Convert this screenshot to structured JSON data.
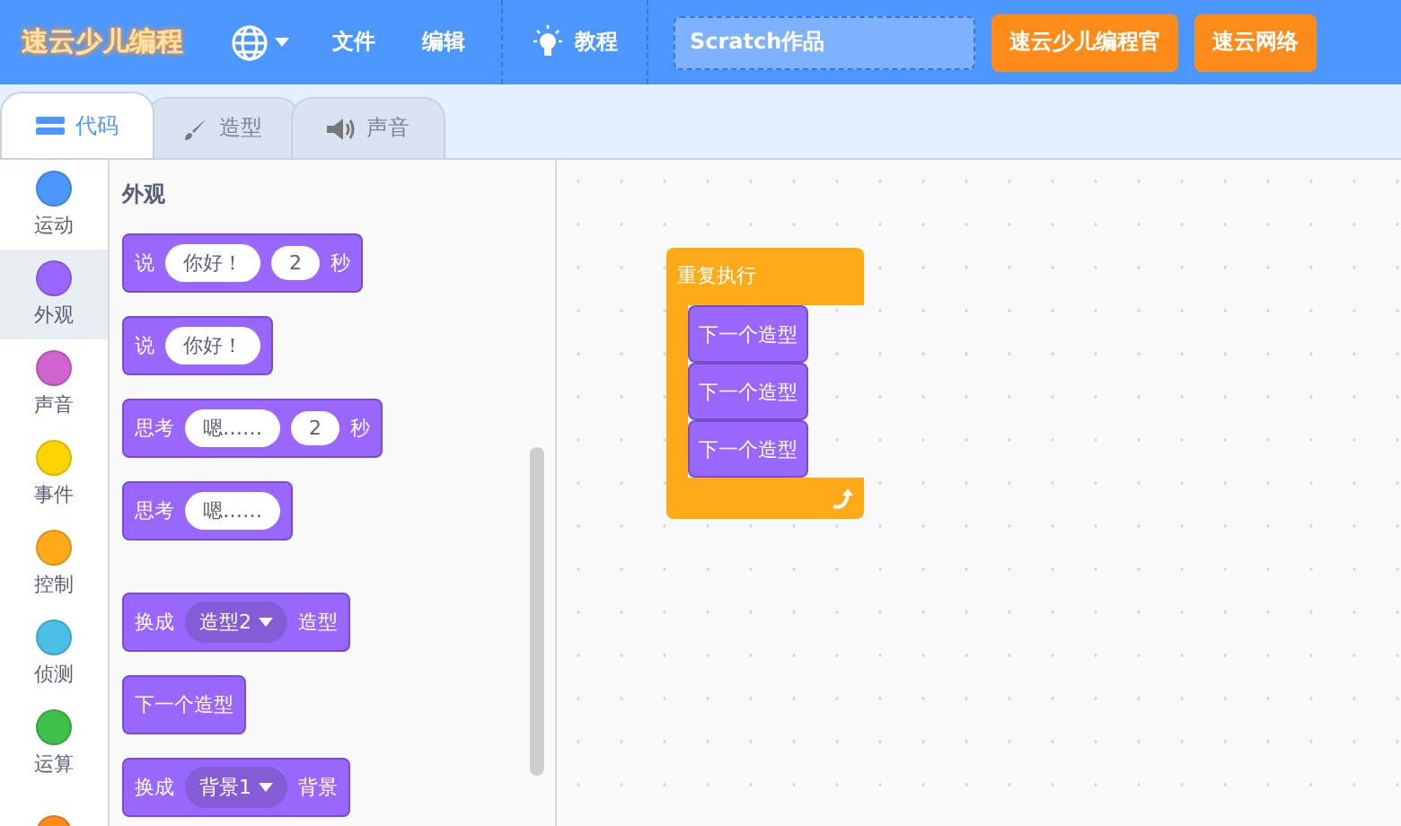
{
  "menu": {
    "logo": "速云少儿编程",
    "items": [
      {
        "label": "文件"
      },
      {
        "label": "编辑"
      }
    ],
    "tutorial": "教程",
    "project_title": "Scratch作品",
    "links": [
      "速云少儿编程官",
      "速云网络"
    ]
  },
  "tabs": [
    {
      "label": "代码",
      "selected": true
    },
    {
      "label": "造型",
      "selected": false
    },
    {
      "label": "声音",
      "selected": false
    }
  ],
  "categories": [
    {
      "label": "运动",
      "color": "#4c97ff",
      "selected": false
    },
    {
      "label": "外观",
      "color": "#9966ff",
      "selected": true
    },
    {
      "label": "声音",
      "color": "#cf63cf",
      "selected": false
    },
    {
      "label": "事件",
      "color": "#ffd500",
      "selected": false
    },
    {
      "label": "控制",
      "color": "#ffab19",
      "selected": false
    },
    {
      "label": "侦测",
      "color": "#4cbfe6",
      "selected": false
    },
    {
      "label": "运算",
      "color": "#40bf4a",
      "selected": false
    },
    {
      "color": "#ff8c1a",
      "selected": false
    }
  ],
  "palette": {
    "heading": "外观",
    "groups": [
      [
        {
          "parts": [
            {
              "kind": "text",
              "text": "说"
            },
            {
              "kind": "input",
              "text": "你好！"
            },
            {
              "kind": "input",
              "text": "2"
            },
            {
              "kind": "text",
              "text": "秒"
            }
          ]
        },
        {
          "parts": [
            {
              "kind": "text",
              "text": "说"
            },
            {
              "kind": "input",
              "text": "你好！"
            }
          ]
        },
        {
          "parts": [
            {
              "kind": "text",
              "text": "思考"
            },
            {
              "kind": "input",
              "text": "嗯……"
            },
            {
              "kind": "input",
              "text": "2"
            },
            {
              "kind": "text",
              "text": "秒"
            }
          ]
        },
        {
          "parts": [
            {
              "kind": "text",
              "text": "思考"
            },
            {
              "kind": "input",
              "text": "嗯……"
            }
          ]
        }
      ],
      [
        {
          "parts": [
            {
              "kind": "text",
              "text": "换成"
            },
            {
              "kind": "dropdown",
              "text": "造型2"
            },
            {
              "kind": "text",
              "text": "造型"
            }
          ]
        },
        {
          "parts": [
            {
              "kind": "text",
              "text": "下一个造型"
            }
          ]
        },
        {
          "parts": [
            {
              "kind": "text",
              "text": "换成"
            },
            {
              "kind": "dropdown",
              "text": "背景1"
            },
            {
              "kind": "text",
              "text": "背景"
            }
          ]
        }
      ]
    ]
  },
  "script": {
    "label": "重复执行",
    "children": [
      "下一个造型",
      "下一个造型",
      "下一个造型"
    ]
  }
}
